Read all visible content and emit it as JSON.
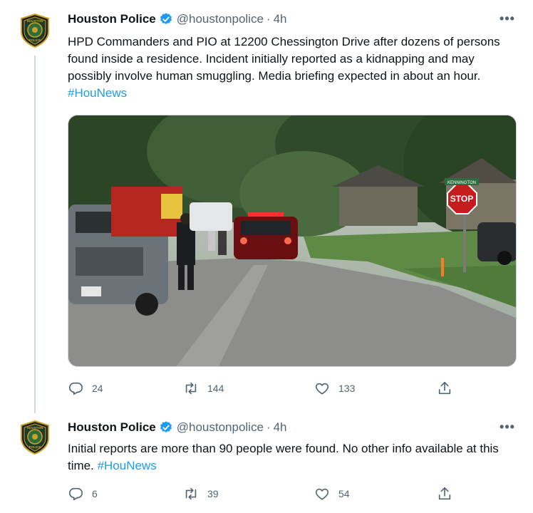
{
  "tweets": [
    {
      "author": {
        "name": "Houston Police",
        "handle": "@houstonpolice",
        "time": "4h"
      },
      "text": "HPD Commanders and PIO at 12200 Chessington Drive after dozens of persons found inside a residence.  Incident initially reported as a kidnapping and may possibly involve human smuggling. Media briefing expected in about an hour. ",
      "hashtag": "#HouNews",
      "counts": {
        "replies": "24",
        "retweets": "144",
        "likes": "133"
      },
      "photo_signs": {
        "stop": "STOP",
        "street": "KENNINGTON"
      }
    },
    {
      "author": {
        "name": "Houston Police",
        "handle": "@houstonpolice",
        "time": "4h"
      },
      "text": "Initial reports are more than 90 people were found.  No other info available at this time. ",
      "hashtag": "#HouNews",
      "counts": {
        "replies": "6",
        "retweets": "39",
        "likes": "54"
      }
    }
  ],
  "badge": {
    "top": "HOUSTON",
    "bottom": "POLICE"
  },
  "dot": "·",
  "more_glyph": "•••",
  "colors": {
    "link": "#1d9bf0",
    "muted": "#536471",
    "verified": "#1d9bf0"
  },
  "icons": [
    "reply-icon",
    "retweet-icon",
    "like-icon",
    "share-icon",
    "verified-badge-icon",
    "more-icon"
  ]
}
